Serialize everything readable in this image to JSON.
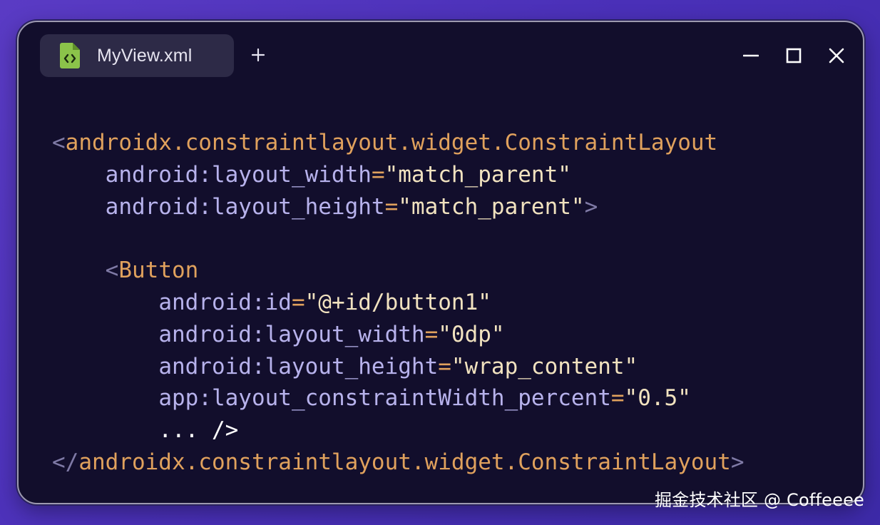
{
  "tab": {
    "title": "MyView.xml",
    "icon": "xml-file-icon",
    "icon_color": "#8bc34a"
  },
  "new_tab": {
    "icon": "plus-icon"
  },
  "window_controls": {
    "minimize": "minimize-icon",
    "maximize": "maximize-icon",
    "close": "close-icon"
  },
  "code": {
    "l1_open": "<",
    "l1_tag": "androidx.constraintlayout.widget.ConstraintLayout",
    "l2_attr": "android:layout_width",
    "l2_eq": "=",
    "l2_val": "\"match_parent\"",
    "l3_attr": "android:layout_height",
    "l3_eq": "=",
    "l3_val": "\"match_parent\"",
    "l3_close": ">",
    "l5_open": "<",
    "l5_tag": "Button",
    "l6_attr": "android:id",
    "l6_eq": "=",
    "l6_val": "\"@+id/button1\"",
    "l7_attr": "android:layout_width",
    "l7_eq": "=",
    "l7_val": "\"0dp\"",
    "l8_attr": "android:layout_height",
    "l8_eq": "=",
    "l8_val": "\"wrap_content\"",
    "l9_attr": "app:layout_constraintWidth_percent",
    "l9_eq": "=",
    "l9_val": "\"0.5\"",
    "l10_text": "... />",
    "l11_open": "</",
    "l11_tag": "androidx.constraintlayout.widget.ConstraintLayout",
    "l11_close": ">"
  },
  "watermark": "掘金技术社区 @ Coffeeee",
  "colors": {
    "background": "#4a30b8",
    "window": "#120e2c",
    "tag": "#e0a15d",
    "attribute": "#b7b2ec",
    "string": "#f1e2bf"
  }
}
